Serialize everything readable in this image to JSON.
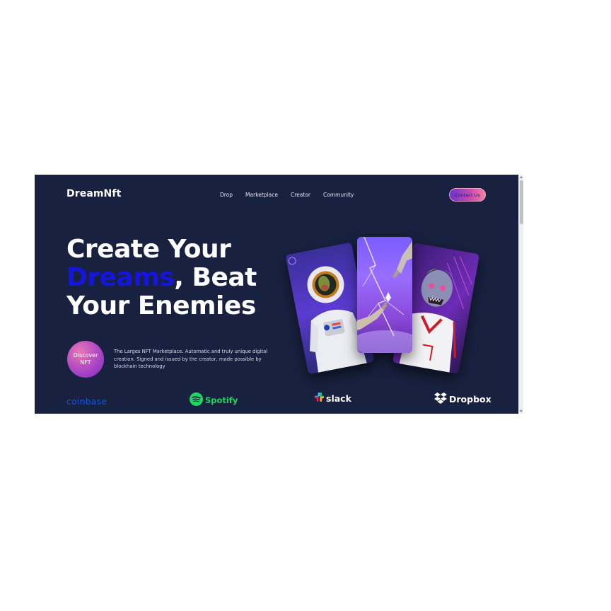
{
  "header": {
    "logo": "DreamNft",
    "nav": [
      "Drop",
      "Marketplace",
      "Creator",
      "Community"
    ],
    "contact_label": "Contact Us"
  },
  "hero": {
    "title_line1": "Create Your",
    "title_highlight": "Dreams",
    "title_line2_rest": ", Beat",
    "title_line3": "Your Enemies",
    "discover_line1": "Discover",
    "discover_line2": "NFT",
    "description": "The Larges NFT Marketplace. Automatic and truly unique digital creation. Signed and issued by the creator, made possible by blockhain technology"
  },
  "brands": [
    "coinbase",
    "Spotify",
    "slack",
    "Dropbox"
  ],
  "colors": {
    "background": "#18213f",
    "highlight": "#1515e0",
    "button_gradient_start": "#6a34d0",
    "button_gradient_end": "#f47fa0",
    "spotify": "#1ed760",
    "coinbase": "#1652f0"
  },
  "icons": [
    "cursor-icon",
    "spotify-icon",
    "slack-icon",
    "dropbox-icon"
  ]
}
